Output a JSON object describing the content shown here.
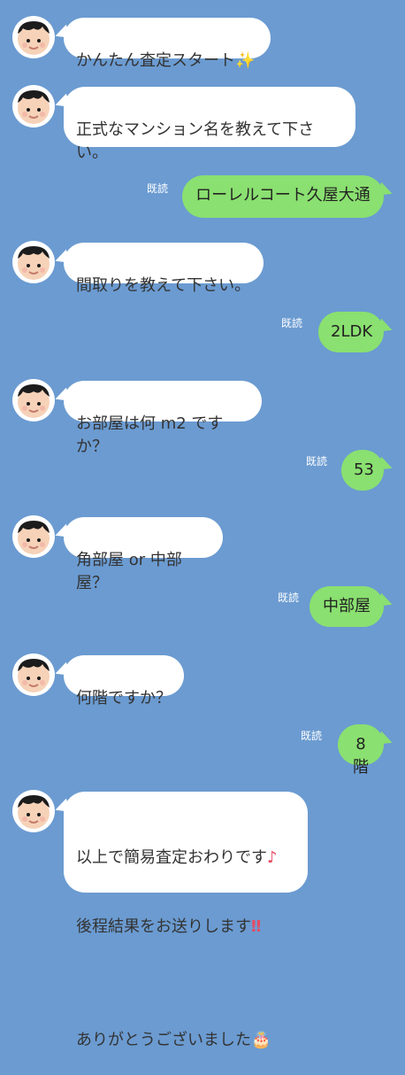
{
  "messages": [
    {
      "from": "bot",
      "text": "かんたん査定スタート",
      "emoji": "✨"
    },
    {
      "from": "bot",
      "text": "正式なマンション名を教えて下さ\nい。"
    },
    {
      "from": "user",
      "text": "ローレルコート久屋大通",
      "read": "既読"
    },
    {
      "from": "bot",
      "text": "間取りを教えて下さい。"
    },
    {
      "from": "user",
      "text": "2LDK",
      "read": "既読"
    },
    {
      "from": "bot",
      "text": "お部屋は何 m2 ですか？"
    },
    {
      "from": "user",
      "text": "53",
      "read": "既読"
    },
    {
      "from": "bot",
      "text": "角部屋 or 中部屋？"
    },
    {
      "from": "user",
      "text": "中部屋",
      "read": "既読"
    },
    {
      "from": "bot",
      "text": "何階ですか？"
    },
    {
      "from": "user",
      "text": "8階",
      "read": "既読"
    },
    {
      "from": "bot",
      "text_line1": "以上で簡易査定おわりです",
      "emoji1": "♪",
      "text_line2": "後程結果をお送りします",
      "emoji2": "‼",
      "text_line3": "ありがとうございました",
      "emoji3": "🎂"
    }
  ],
  "colors": {
    "background": "#6b9bd1",
    "incoming_bubble": "#ffffff",
    "outgoing_bubble": "#8ae070",
    "text": "#333333",
    "read_mark": "#ffffff"
  }
}
